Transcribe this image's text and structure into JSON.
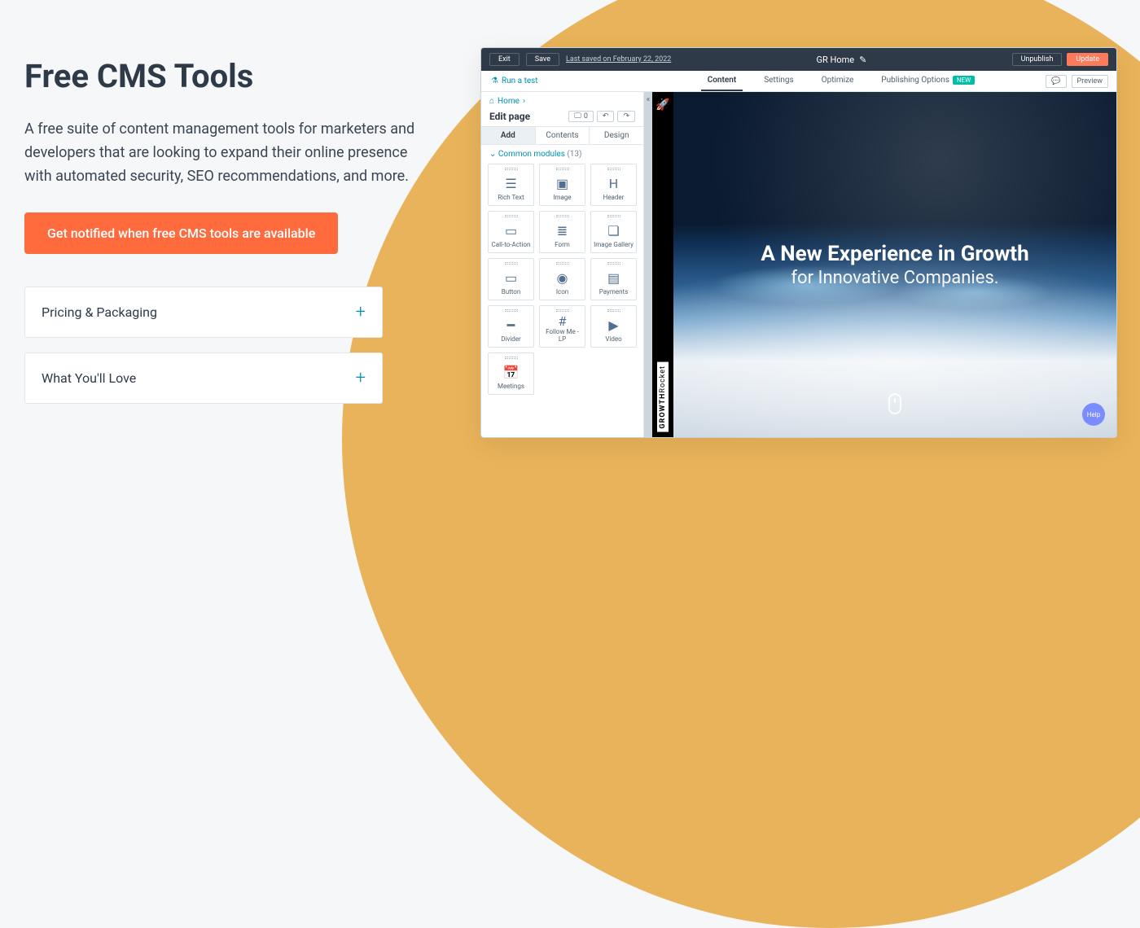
{
  "page": {
    "heading": "Free CMS Tools",
    "subheading": "A free suite of content management tools for marketers and developers that are looking to expand their online presence with automated security, SEO recommendations, and more.",
    "cta_label": "Get notified when free CMS tools are available",
    "accordion": [
      {
        "title": "Pricing & Packaging"
      },
      {
        "title": "What You'll Love"
      }
    ]
  },
  "editor": {
    "topbar": {
      "exit": "Exit",
      "save": "Save",
      "last_saved": "Last saved on February 22, 2022",
      "page_name": "GR Home",
      "unpublish": "Unpublish",
      "update": "Update"
    },
    "tabbar": {
      "run_a_test": "Run a test",
      "tabs": {
        "content": "Content",
        "settings": "Settings",
        "optimize": "Optimize",
        "publishing": "Publishing Options",
        "new_pill": "NEW"
      },
      "preview": "Preview",
      "chat_icon_count": ""
    },
    "side": {
      "breadcrumb": "Home",
      "edit_page": "Edit page",
      "zero_badge": "0",
      "inner_tabs": {
        "add": "Add",
        "contents": "Contents",
        "design": "Design"
      },
      "group_label": "Common modules",
      "group_count": "(13)",
      "modules": [
        {
          "id": "rich-text",
          "label": "Rich Text",
          "icon": "☰"
        },
        {
          "id": "image",
          "label": "Image",
          "icon": "▣"
        },
        {
          "id": "header",
          "label": "Header",
          "icon": "H"
        },
        {
          "id": "cta",
          "label": "Call-to-Action",
          "icon": "▭"
        },
        {
          "id": "form",
          "label": "Form",
          "icon": "≣"
        },
        {
          "id": "image-gallery",
          "label": "Image Gallery",
          "icon": "❏"
        },
        {
          "id": "button",
          "label": "Button",
          "icon": "▭"
        },
        {
          "id": "icon",
          "label": "Icon",
          "icon": "◉"
        },
        {
          "id": "payments",
          "label": "Payments",
          "icon": "▤"
        },
        {
          "id": "divider",
          "label": "Divider",
          "icon": "━"
        },
        {
          "id": "follow-me",
          "label": "Follow Me - LP",
          "icon": "#"
        },
        {
          "id": "video",
          "label": "Video",
          "icon": "▶"
        },
        {
          "id": "meetings",
          "label": "Meetings",
          "icon": "📅"
        }
      ]
    },
    "launcher": {
      "brand_bold": "GROWTH",
      "brand_light": "Rocket"
    },
    "canvas": {
      "line1": "A New Experience in Growth",
      "line2": "for Innovative Companies."
    },
    "help_label": "Help"
  }
}
